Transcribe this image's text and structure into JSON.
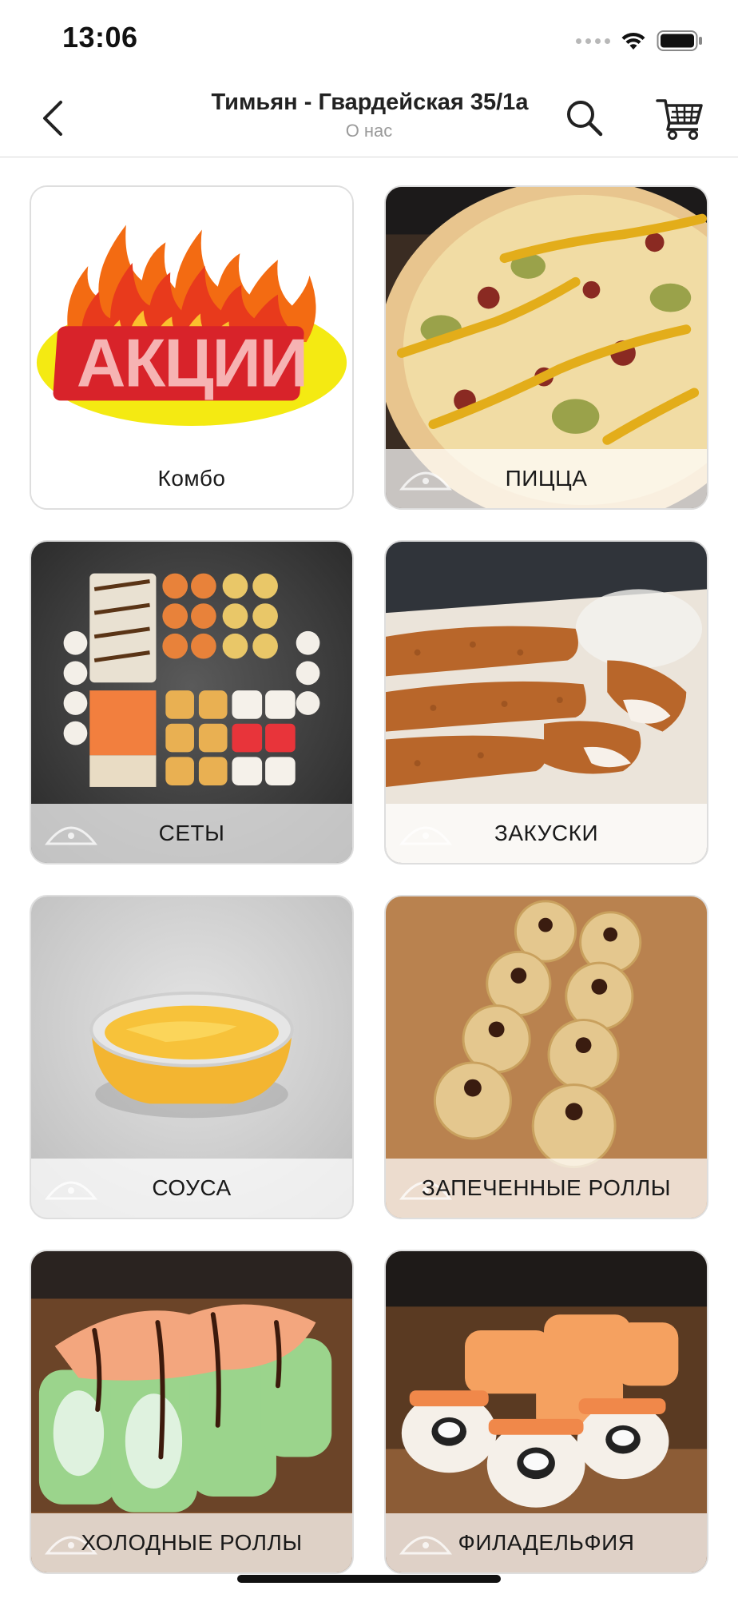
{
  "status_bar": {
    "time": "13:06"
  },
  "header": {
    "title": "Тимьян - Гвардейская 35/1а",
    "subtitle": "О нас"
  },
  "promo_logo_text": "АКЦИИ",
  "categories": [
    {
      "label": "Комбо"
    },
    {
      "label": "ПИЦЦА"
    },
    {
      "label": "СЕТЫ"
    },
    {
      "label": "ЗАКУСКИ"
    },
    {
      "label": "СОУСА"
    },
    {
      "label": "ЗАПЕЧЕННЫЕ РОЛЛЫ"
    },
    {
      "label": "ХОЛОДНЫЕ РОЛЛЫ"
    },
    {
      "label": "ФИЛАДЕЛЬФИЯ"
    }
  ],
  "icons": {
    "back": "chevron-left-icon",
    "search": "search-icon",
    "cart": "cart-icon"
  },
  "colors": {
    "promo_yellow": "#f4ea12",
    "promo_red": "#d8232a",
    "flame_orange": "#f36b12"
  }
}
